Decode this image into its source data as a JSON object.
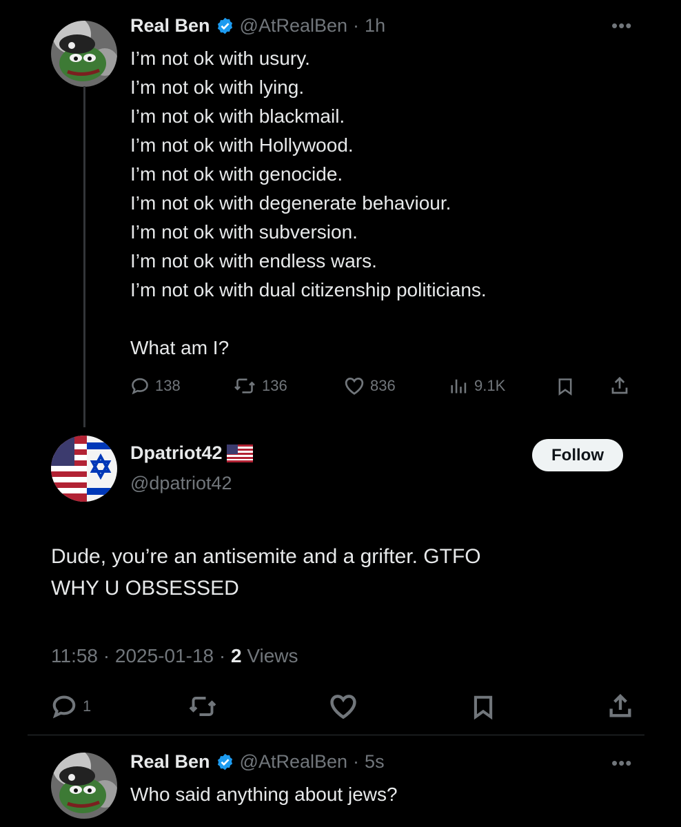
{
  "tweet1": {
    "author_name": "Real Ben",
    "handle": "@AtRealBen",
    "time": "1h",
    "lines": [
      "I’m not ok with usury.",
      "I’m not ok with lying.",
      "I’m not ok with blackmail.",
      "I’m not ok with Hollywood.",
      "I’m not ok with genocide.",
      "I’m not ok with degenerate behaviour.",
      "I’m not ok with subversion.",
      "I’m not ok with endless wars.",
      "I’m not ok with dual citizenship politicians."
    ],
    "question": "What am I?",
    "replies": "138",
    "reposts": "136",
    "likes": "836",
    "views": "9.1K"
  },
  "reply": {
    "author_name": "Dpatriot42",
    "handle": "@dpatriot42",
    "follow_label": "Follow",
    "text_line1": "Dude, you’re an antisemite and a grifter. GTFO",
    "text_line2": "WHY U OBSESSED",
    "timestamp": "11:58 · 2025-01-18 · ",
    "view_count": "2",
    "view_label": " Views",
    "reply_count": "1"
  },
  "tweet2": {
    "author_name": "Real Ben",
    "handle": "@AtRealBen",
    "time": "5s",
    "text": "Who said anything about jews?"
  },
  "icons": {
    "verified_badge": "verified-badge-icon",
    "more": "more-icon",
    "reply": "reply-icon",
    "repost": "repost-icon",
    "like": "like-icon",
    "views": "views-icon",
    "bookmark": "bookmark-icon",
    "share": "share-icon"
  },
  "colors": {
    "background": "#000000",
    "text": "#e7e9ea",
    "muted": "#71767b",
    "verified": "#1d9bf0",
    "follow_bg": "#eff3f4"
  }
}
